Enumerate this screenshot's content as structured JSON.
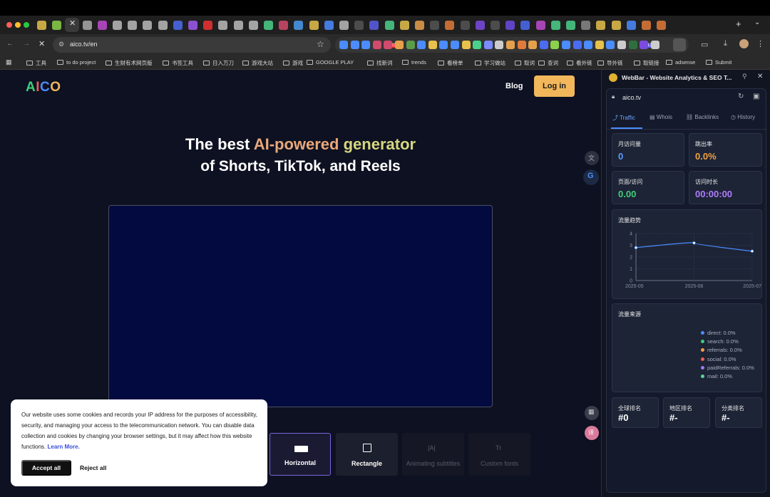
{
  "browser": {
    "url": "aico.tv/en",
    "bookmarks": [
      "工具",
      "to do project",
      "生财有术网页版",
      "书签工具",
      "日入万刀",
      "游戏大站",
      "游戏",
      "GOOGLE PLAY",
      "找新词",
      "trends",
      "看榜单",
      "学习做站",
      "取词",
      "查词",
      "看外链",
      "导外链",
      "取链接",
      "adsense",
      "Submit"
    ],
    "ext_badge_1": "1423",
    "ext_badge_2": "13"
  },
  "site": {
    "logo": "AICO",
    "nav_blog": "Blog",
    "nav_login": "Log in",
    "hero_prefix": "The best ",
    "hero_highlight_1": "AI-powered",
    "hero_highlight_2": " generator",
    "hero_line2": "of Shorts, TikTok, and Reels",
    "options": [
      {
        "label": "Horizontal"
      },
      {
        "label": "Rectangle"
      },
      {
        "label": "Animating subtitles"
      },
      {
        "label": "Custom fonts"
      }
    ]
  },
  "cookie": {
    "text": "Our website uses some cookies and records your IP address for the purposes of accessibility, security, and managing your access to the telecommunication network. You can disable data collection and cookies by changing your browser settings, but it may affect how this website functions.",
    "learn_more": "Learn More.",
    "accept": "Accept all",
    "reject": "Reject all"
  },
  "panel": {
    "title": "WebBar - Website Analytics & SEO T...",
    "domain": "aico.tv",
    "tabs": [
      "Traffic",
      "Whois",
      "Backlinks",
      "History"
    ],
    "stats": [
      {
        "label": "月访问量",
        "value": "0",
        "color": "#5b9cff"
      },
      {
        "label": "跳出率",
        "value": "0.0%",
        "color": "#f0a040"
      },
      {
        "label": "页面/访问",
        "value": "0.00",
        "color": "#3ecf7a"
      },
      {
        "label": "访问时长",
        "value": "00:00:00",
        "color": "#b07cff"
      }
    ],
    "trend_title": "流量趋势",
    "source_title": "流量来源",
    "sources": [
      {
        "label": "direct: 0.0%",
        "color": "#4b8cff"
      },
      {
        "label": "search: 0.0%",
        "color": "#3ecf7a"
      },
      {
        "label": "referrals: 0.0%",
        "color": "#f0a040"
      },
      {
        "label": "social: 0.0%",
        "color": "#ef5a5a"
      },
      {
        "label": "paidReferrals: 0.0%",
        "color": "#9b7cf0"
      },
      {
        "label": "mail: 0.0%",
        "color": "#5fd0a0"
      }
    ],
    "ranks": [
      {
        "label": "全球排名",
        "value": "#0"
      },
      {
        "label": "地区排名",
        "value": "#-"
      },
      {
        "label": "分类排名",
        "value": "#-"
      }
    ]
  },
  "chart_data": {
    "type": "line",
    "title": "流量趋势",
    "categories": [
      "2025-05",
      "2025-06",
      "2025-07"
    ],
    "y_ticks": [
      0,
      1,
      2,
      3,
      4
    ],
    "ylim": [
      0,
      4
    ],
    "series": [
      {
        "values": [
          2.8,
          3.2,
          2.5
        ]
      }
    ],
    "grid": true
  }
}
